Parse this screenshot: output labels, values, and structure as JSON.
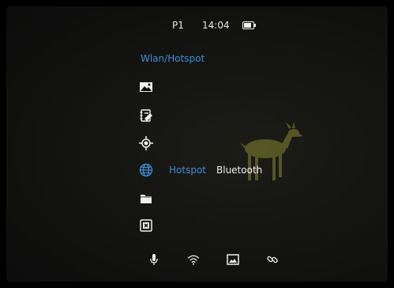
{
  "status_bar": {
    "profile": "P1",
    "time": "14:04",
    "battery_icon": "battery-icon"
  },
  "menu": {
    "title": "Wlan/Hotspot",
    "icons": [
      "image-icon",
      "edit-list-icon",
      "crosshair-icon",
      "globe-icon",
      "folder-icon",
      "settings-box-icon"
    ],
    "selected_icon": "globe-icon",
    "options": [
      {
        "label": "Hotspot",
        "selected": true
      },
      {
        "label": "Bluetooth",
        "selected": false
      }
    ]
  },
  "bottom_bar": {
    "icons": [
      "microphone-icon",
      "wifi-icon",
      "photo-mode-icon",
      "link-icon"
    ]
  },
  "colors": {
    "accent": "#3d8fd6",
    "text": "#f0f0f0",
    "background": "#000000"
  }
}
